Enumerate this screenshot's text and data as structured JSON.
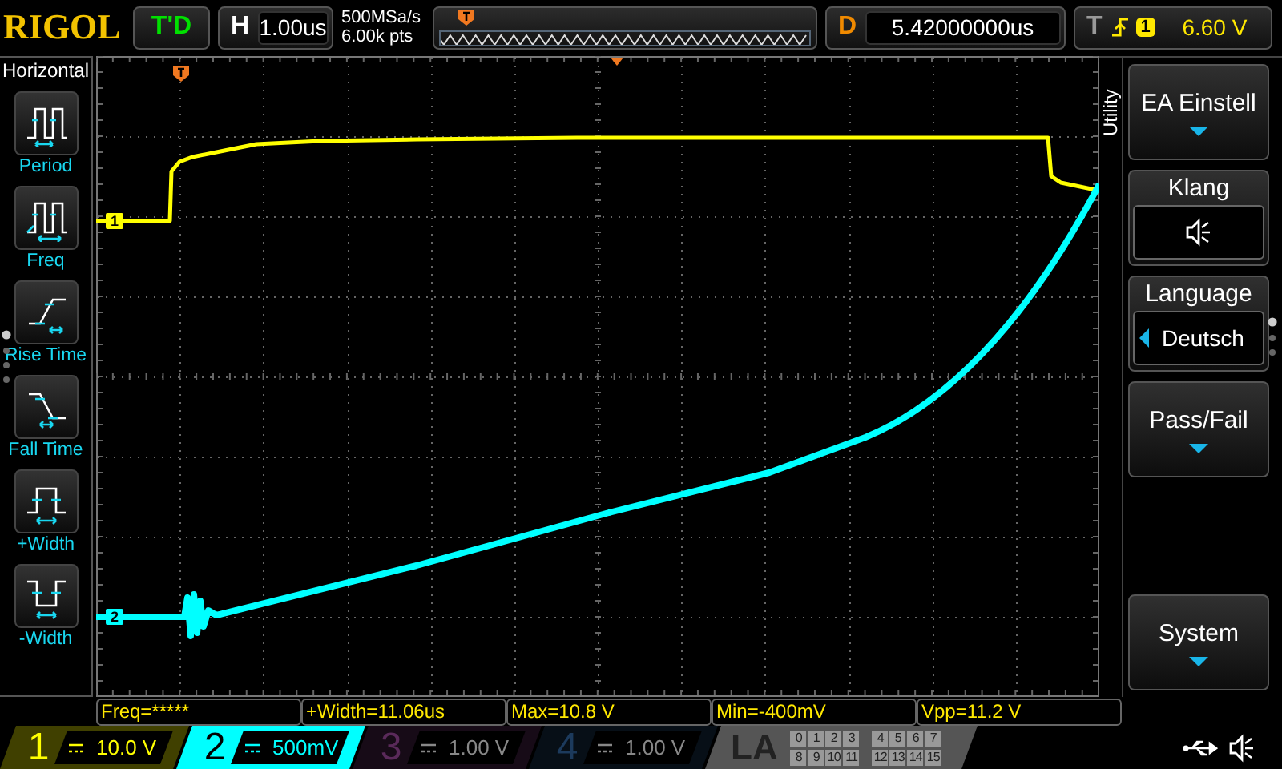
{
  "brand": "RIGOL",
  "run_status": "T'D",
  "horizontal": {
    "label": "H",
    "timebase": "1.00us"
  },
  "acquisition": {
    "sample_rate": "500MSa/s",
    "memory_depth": "6.00k pts"
  },
  "delay": {
    "label": "D",
    "value": "5.42000000us"
  },
  "trigger": {
    "label": "T",
    "source": "1",
    "level": "6.60 V"
  },
  "left_menu": {
    "title": "Horizontal",
    "items": [
      {
        "label": "Period",
        "kind": "period"
      },
      {
        "label": "Freq",
        "kind": "freq"
      },
      {
        "label": "Rise Time",
        "kind": "rise"
      },
      {
        "label": "Fall Time",
        "kind": "fall"
      },
      {
        "label": "+Width",
        "kind": "pwidth"
      },
      {
        "label": "-Width",
        "kind": "nwidth"
      }
    ]
  },
  "traces": [
    {
      "marker": "1",
      "kind": "pulse",
      "color": "#ffff00"
    },
    {
      "marker": "2",
      "kind": "ramp",
      "color": "#00ffff"
    }
  ],
  "right_menu": {
    "title": "Utility",
    "items": [
      {
        "kind": "submenu",
        "label": "EA Einstell"
      },
      {
        "kind": "sound",
        "label": "Klang",
        "on": true
      },
      {
        "kind": "select",
        "label": "Language",
        "value": "Deutsch"
      },
      {
        "kind": "submenu",
        "label": "Pass/Fail"
      },
      {
        "kind": "submenu",
        "label": "System"
      }
    ]
  },
  "measurements": [
    "Freq=*****",
    "+Width=11.06us",
    "Max=10.8 V",
    "Min=-400mV",
    "Vpp=11.2 V"
  ],
  "channels": [
    {
      "number": "1",
      "scale": "10.0 V",
      "active": true,
      "selected": false,
      "color": "#ffff00"
    },
    {
      "number": "2",
      "scale": "500mV",
      "active": true,
      "selected": true,
      "color": "#00ffff"
    },
    {
      "number": "3",
      "scale": "1.00 V",
      "active": false,
      "selected": false,
      "color": "#5a2a5a"
    },
    {
      "number": "4",
      "scale": "1.00 V",
      "active": false,
      "selected": false,
      "color": "#1c3a5c"
    }
  ],
  "logic_analyzer": {
    "label": "LA",
    "bits": [
      "0",
      "1",
      "2",
      "3",
      "4",
      "5",
      "6",
      "7",
      "8",
      "9",
      "10",
      "11",
      "12",
      "13",
      "14",
      "15"
    ]
  }
}
